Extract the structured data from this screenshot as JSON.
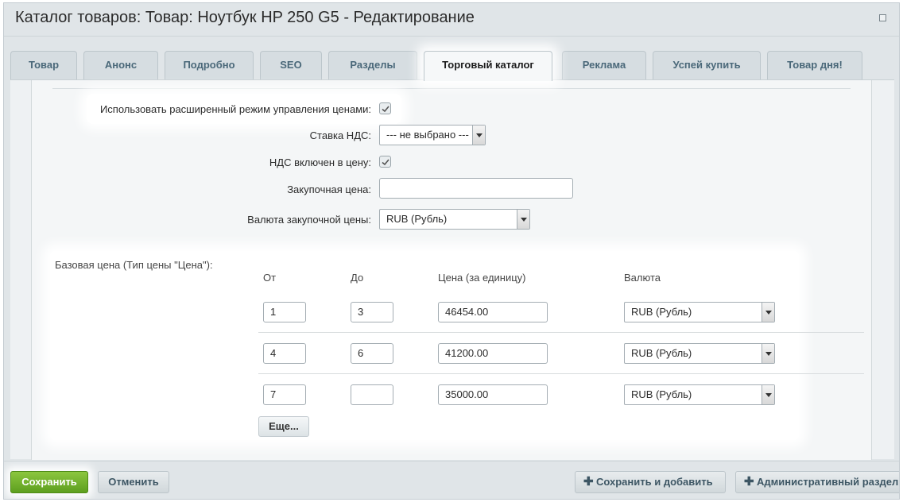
{
  "window": {
    "title": "Каталог товаров: Товар: Ноутбук HP 250 G5 - Редактирование"
  },
  "tabs": [
    {
      "label": "Товар"
    },
    {
      "label": "Анонс"
    },
    {
      "label": "Подробно"
    },
    {
      "label": "SEO"
    },
    {
      "label": "Разделы"
    },
    {
      "label": "Торговый каталог",
      "active": true
    },
    {
      "label": "Реклама"
    },
    {
      "label": "Успей купить"
    },
    {
      "label": "Товар дня!"
    }
  ],
  "form": {
    "extended_price_mode_label": "Использовать расширенный режим управления ценами:",
    "extended_price_mode_checked": true,
    "vat_rate_label": "Ставка НДС:",
    "vat_rate_value": "--- не выбрано ---",
    "vat_included_label": "НДС включен в цену:",
    "vat_included_checked": true,
    "purchase_price_label": "Закупочная цена:",
    "purchase_price_value": "",
    "purchase_currency_label": "Валюта закупочной цены:",
    "purchase_currency_value": "RUB (Рубль)"
  },
  "price_table": {
    "section_label": "Базовая цена (Тип цены \"Цена\"):",
    "headers": {
      "from": "От",
      "to": "До",
      "price": "Цена (за единицу)",
      "currency": "Валюта"
    },
    "rows": [
      {
        "from": "1",
        "to": "3",
        "price": "46454.00",
        "currency": "RUB (Рубль)"
      },
      {
        "from": "4",
        "to": "6",
        "price": "41200.00",
        "currency": "RUB (Рубль)"
      },
      {
        "from": "7",
        "to": "",
        "price": "35000.00",
        "currency": "RUB (Рубль)"
      }
    ],
    "more_button": "Еще..."
  },
  "footer": {
    "save": "Сохранить",
    "cancel": "Отменить",
    "save_and_add": "Сохранить и добавить",
    "admin_section": "Административный раздел"
  },
  "colors": {
    "save_button": "#6aab2a",
    "tab_text": "#4a6879",
    "background": "#e0e5e8"
  }
}
